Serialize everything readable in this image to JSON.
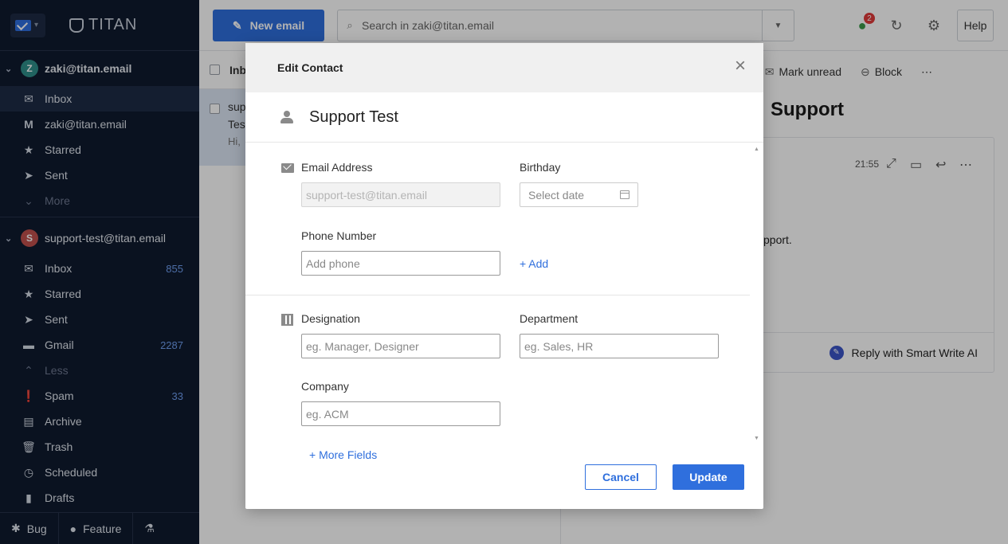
{
  "brand": {
    "name": "TITAN"
  },
  "topbar": {
    "new_email": "New email",
    "search_placeholder": "Search in zaki@titan.email",
    "notification_count": "2",
    "help": "Help"
  },
  "accounts": [
    {
      "name": "zaki@titan.email",
      "initial": "Z",
      "color": "#2f8f8a",
      "items": [
        {
          "label": "Inbox",
          "icon": "inbox-icon"
        },
        {
          "label": "zaki@titan.email",
          "icon": "gmail-icon"
        },
        {
          "label": "Starred",
          "icon": "star-icon"
        },
        {
          "label": "Sent",
          "icon": "send-icon"
        },
        {
          "label": "More",
          "icon": "chevron-down-icon"
        }
      ]
    },
    {
      "name": "support-test@titan.email",
      "initial": "S",
      "color": "#c0504d",
      "items": [
        {
          "label": "Inbox",
          "count": "855",
          "icon": "inbox-icon"
        },
        {
          "label": "Starred",
          "icon": "star-icon"
        },
        {
          "label": "Sent",
          "icon": "send-icon"
        },
        {
          "label": "Gmail",
          "count": "2287",
          "icon": "folder-icon"
        },
        {
          "label": "Less",
          "icon": "chevron-up-icon"
        },
        {
          "label": "Spam",
          "count": "33",
          "icon": "spam-icon"
        },
        {
          "label": "Archive",
          "icon": "archive-icon"
        },
        {
          "label": "Trash",
          "icon": "trash-icon"
        },
        {
          "label": "Scheduled",
          "icon": "clock-icon"
        },
        {
          "label": "Drafts",
          "icon": "draft-icon"
        }
      ]
    }
  ],
  "footer": {
    "bug": "Bug",
    "feature": "Feature"
  },
  "list": {
    "header": "Inb",
    "row": {
      "line1": "sup",
      "line2": "Test",
      "line3": "Hi,"
    }
  },
  "reading": {
    "mark_unread": "Mark unread",
    "block": "Block",
    "subject": "Support",
    "time": "21:55",
    "body_fragment": "pport.",
    "reply_ai": "Reply with Smart Write AI"
  },
  "modal": {
    "title": "Edit Contact",
    "contact_name": "Support Test",
    "email_label": "Email Address",
    "email_value": "support-test@titan.email",
    "birthday_label": "Birthday",
    "birthday_placeholder": "Select date",
    "phone_label": "Phone Number",
    "phone_placeholder": "Add phone",
    "add_link": "+ Add",
    "designation_label": "Designation",
    "designation_placeholder": "eg. Manager, Designer",
    "department_label": "Department",
    "department_placeholder": "eg. Sales, HR",
    "company_label": "Company",
    "company_placeholder": "eg. ACM",
    "more_fields": "+ More Fields",
    "cancel": "Cancel",
    "update": "Update"
  }
}
